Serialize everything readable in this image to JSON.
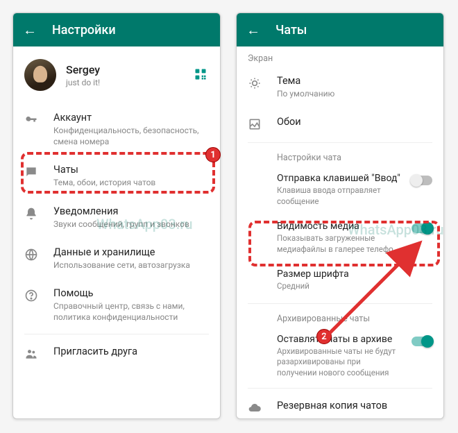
{
  "left": {
    "header": "Настройки",
    "profile": {
      "name": "Sergey",
      "status": "just do it!"
    },
    "items": [
      {
        "title": "Аккаунт",
        "sub": "Конфиденциальность, безопасность, смена номера"
      },
      {
        "title": "Чаты",
        "sub": "Тема, обои, история чатов"
      },
      {
        "title": "Уведомления",
        "sub": "Звуки сообщений, групп и звонков"
      },
      {
        "title": "Данные и хранилище",
        "sub": "Использование сети, автозагрузка"
      },
      {
        "title": "Помощь",
        "sub": "Справочный центр, связь с нами, политика конфиденциальности"
      },
      {
        "title": "Пригласить друга"
      }
    ]
  },
  "right": {
    "header": "Чаты",
    "section_screen": "Экран",
    "theme": {
      "title": "Тема",
      "sub": "По умолчанию"
    },
    "wallpaper": "Обои",
    "section_chat": "Настройки чата",
    "enter_send": {
      "title": "Отправка клавишей \"Ввод\"",
      "sub": "Клавиша ввода отправляет сообщение"
    },
    "media_vis": {
      "title": "Видимость медиа",
      "sub": "Показывать загруженные медиафайлы в галерее телефо"
    },
    "font_size": {
      "title": "Размер шрифта",
      "sub": "Средний"
    },
    "section_archive": "Архивированные чаты",
    "keep_archived": {
      "title": "Оставлять чаты в архиве",
      "sub": "Архивированные чаты не будут разархивированы при получении нового сообщения"
    },
    "backup": "Резервная копия чатов"
  },
  "badges": {
    "one": "1",
    "two": "2"
  },
  "watermark": "WhatsApp03.ru"
}
